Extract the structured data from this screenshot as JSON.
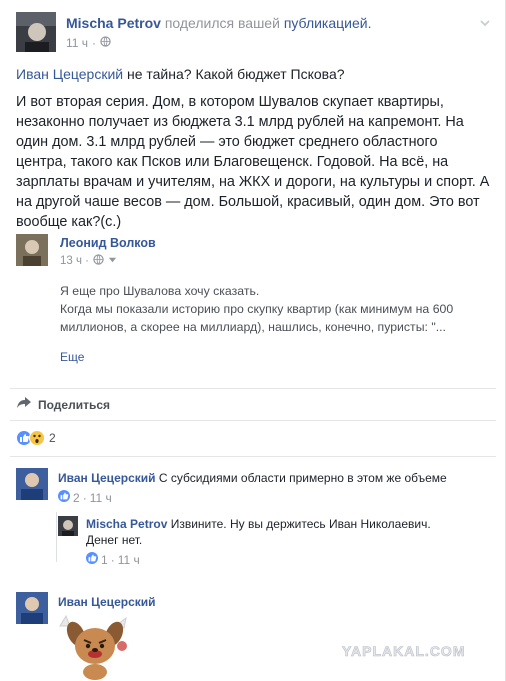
{
  "header": {
    "author": "Mischa Petrov",
    "action": "поделился вашей",
    "target": "публикацией.",
    "time": "11 ч",
    "privacy_icon": "globe-icon",
    "menu_icon": "chevron-down-icon"
  },
  "post": {
    "title_link": "Иван Цецерский",
    "title_rest": "не тайна? Какой бюджет Пскова?",
    "body": "И вот вторая серия. Дом, в котором Шувалов скупает квартиры, незаконно получает из бюджета 3.1 млрд рублей на капремонт. На один дом. 3.1 млрд рублей — это бюджет среднего областного центра, такого как Псков или Благовещенск. Годовой. На всё, на зарплаты врачам и учителям, на ЖКХ и дороги, на культуры и спорт. А на другой чаше весов — дом. Большой, красивый, один дом. Это вот вообще как?(с.)"
  },
  "shared": {
    "author": "Леонид Волков",
    "time": "13 ч ·",
    "text_line1": "Я еще про Шувалова хочу сказать.",
    "text_line2": "Когда мы показали историю про скупку квартир (как минимум на 600 миллионов, а скорее на миллиард), нашлись, конечно, пуристы: \"...",
    "more": "Еще"
  },
  "share_bar": {
    "label": "Поделиться",
    "icon": "share-arrow-icon"
  },
  "reactions": {
    "count": "2",
    "icons": [
      "like-icon",
      "wow-icon"
    ]
  },
  "comments": [
    {
      "author": "Иван Цецерский",
      "text": "С субсидиями области примерно в этом же объеме",
      "likes": "2",
      "time": "11 ч"
    },
    {
      "author": "Mischa Petrov",
      "text_line1": "Извините. Ну вы держитесь Иван Николаевич.",
      "text_line2": "Денег нет.",
      "likes": "1",
      "time": "11 ч"
    },
    {
      "author": "Иван Цецерский",
      "sticker": "angry-dog-sticker"
    }
  ],
  "watermark": "YAPLAKAL.COM",
  "colors": {
    "link": "#365899",
    "meta": "#90949c",
    "like_blue": "#5890ff",
    "wow_yellow": "#f7c544"
  }
}
